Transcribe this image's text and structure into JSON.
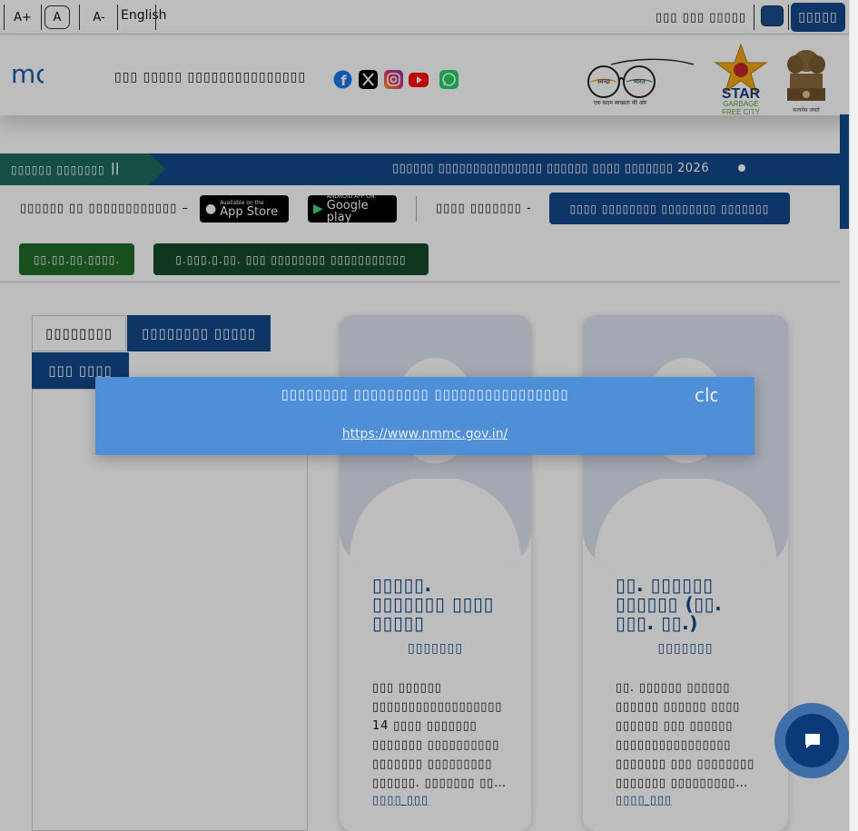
{
  "topbar": {
    "font_increase": "A+",
    "font_default": "A",
    "font_decrease": "A-",
    "language": "English",
    "skip_link": "▯▯▯ ▯▯▯ ▯▯▯▯▯",
    "login": "▯▯▯▯▯"
  },
  "header": {
    "logo_text": "mc",
    "org_name": "▯▯▯ ▯▯▯▯▯ ▯▯▯▯▯▯▯▯▯▯▯▯▯▯▯",
    "social": [
      "facebook-icon",
      "x-icon",
      "instagram-icon",
      "youtube-icon",
      "whatsapp-icon"
    ],
    "swachh_logo_text": "एक कदम स्वच्छता की ओर",
    "swachh_left": "स्वच्छ",
    "swachh_right": "भारत",
    "star_title": "STAR",
    "star_sub1": "GARBAGE",
    "star_sub2": "FREE CITY",
    "emblem_caption": "सत्यमेव जयते"
  },
  "ticker": {
    "label": "▯▯▯▯▯▯ ▯▯▯▯▯▯▯",
    "pause": "||",
    "text": "▯▯▯▯▯▯ ▯▯▯▯▯▯▯▯▯▯▯▯▯▯▯ ▯▯▯▯▯▯ ▯▯▯▯ ▯▯▯▯▯▯▯ 2026"
  },
  "apps": {
    "label": "▯▯▯▯▯▯ ▯▯ ▯▯▯▯▯▯▯▯▯▯▯▯ –",
    "appstore_small": "Available on the",
    "appstore_big": "App Store",
    "googleplay_small": "ANDROID APP ON",
    "googleplay_big": "Google play",
    "other_label": "▯▯▯▯ ▯▯▯▯▯▯▯ -",
    "blue_button": "▯▯▯▯ ▯▯▯▯▯▯▯▯ ▯▯▯▯▯▯▯▯ ▯▯▯▯▯▯▯",
    "green_button_1": "▯▯.▯▯.▯▯.▯▯▯▯.",
    "green_button_2": "▯.▯▯▯.▯.▯▯. ▯▯▯ ▯▯▯▯▯▯▯▯ ▯▯▯▯▯▯▯▯▯▯▯"
  },
  "tabs": [
    "▯▯▯▯▯▯▯▯",
    "▯▯▯▯▯▯▯▯ ▯▯▯▯▯",
    "▯▯▯ ▯▯▯▯"
  ],
  "cards": [
    {
      "name": "▯▯▯▯▯. ▯▯▯▯▯▯▯ ▯▯▯▯ ▯▯▯▯▯",
      "role": "▯▯▯▯▯▯▯",
      "desc": "▯▯▯ ▯▯▯▯▯▯ ▯▯▯▯▯▯▯▯▯▯▯▯▯▯▯▯▯▯ 14 ▯▯▯▯ ▯▯▯▯▯▯▯ ▯▯▯▯▯▯▯ ▯▯▯▯▯▯▯▯▯▯ ▯▯▯▯▯▯▯ ▯▯▯▯▯▯▯▯▯ ▯▯▯▯▯▯. ▯▯▯▯▯▯▯ ▯▯…",
      "more": "▯▯▯▯ ▯▯▯"
    },
    {
      "name": "▯▯. ▯▯▯▯▯▯ ▯▯▯▯▯▯ (▯▯. ▯▯▯. ▯▯.)",
      "role": "▯▯▯▯▯▯▯",
      "desc": "▯▯. ▯▯▯▯▯▯ ▯▯▯▯▯▯ ▯▯▯▯▯▯ ▯▯▯▯▯▯ ▯▯▯▯ ▯▯▯▯▯▯ ▯▯▯ ▯▯▯▯▯▯ ▯▯▯▯▯▯▯▯▯▯▯▯▯▯▯▯ ▯▯▯▯▯▯▯ ▯▯▯ ▯▯▯▯▯▯▯▯ ▯▯▯▯▯▯▯ ▯▯▯▯▯▯▯▯▯…",
      "more": "▯▯▯▯ ▯▯▯"
    }
  ],
  "modal": {
    "title": "▯▯▯▯▯▯▯▯ ▯▯▯▯▯▯▯▯▯ ▯▯▯▯▯▯▯▯▯▯▯▯▯▯▯▯",
    "close": "close",
    "link": "https://www.nmmc.gov.in/"
  },
  "colors": {
    "primary_blue": "#124a8a",
    "dark_green": "#1f6b2a",
    "darker_green": "#154a2b",
    "ticker_green": "#1d6a5a",
    "modal_blue": "#4f8fd8"
  }
}
